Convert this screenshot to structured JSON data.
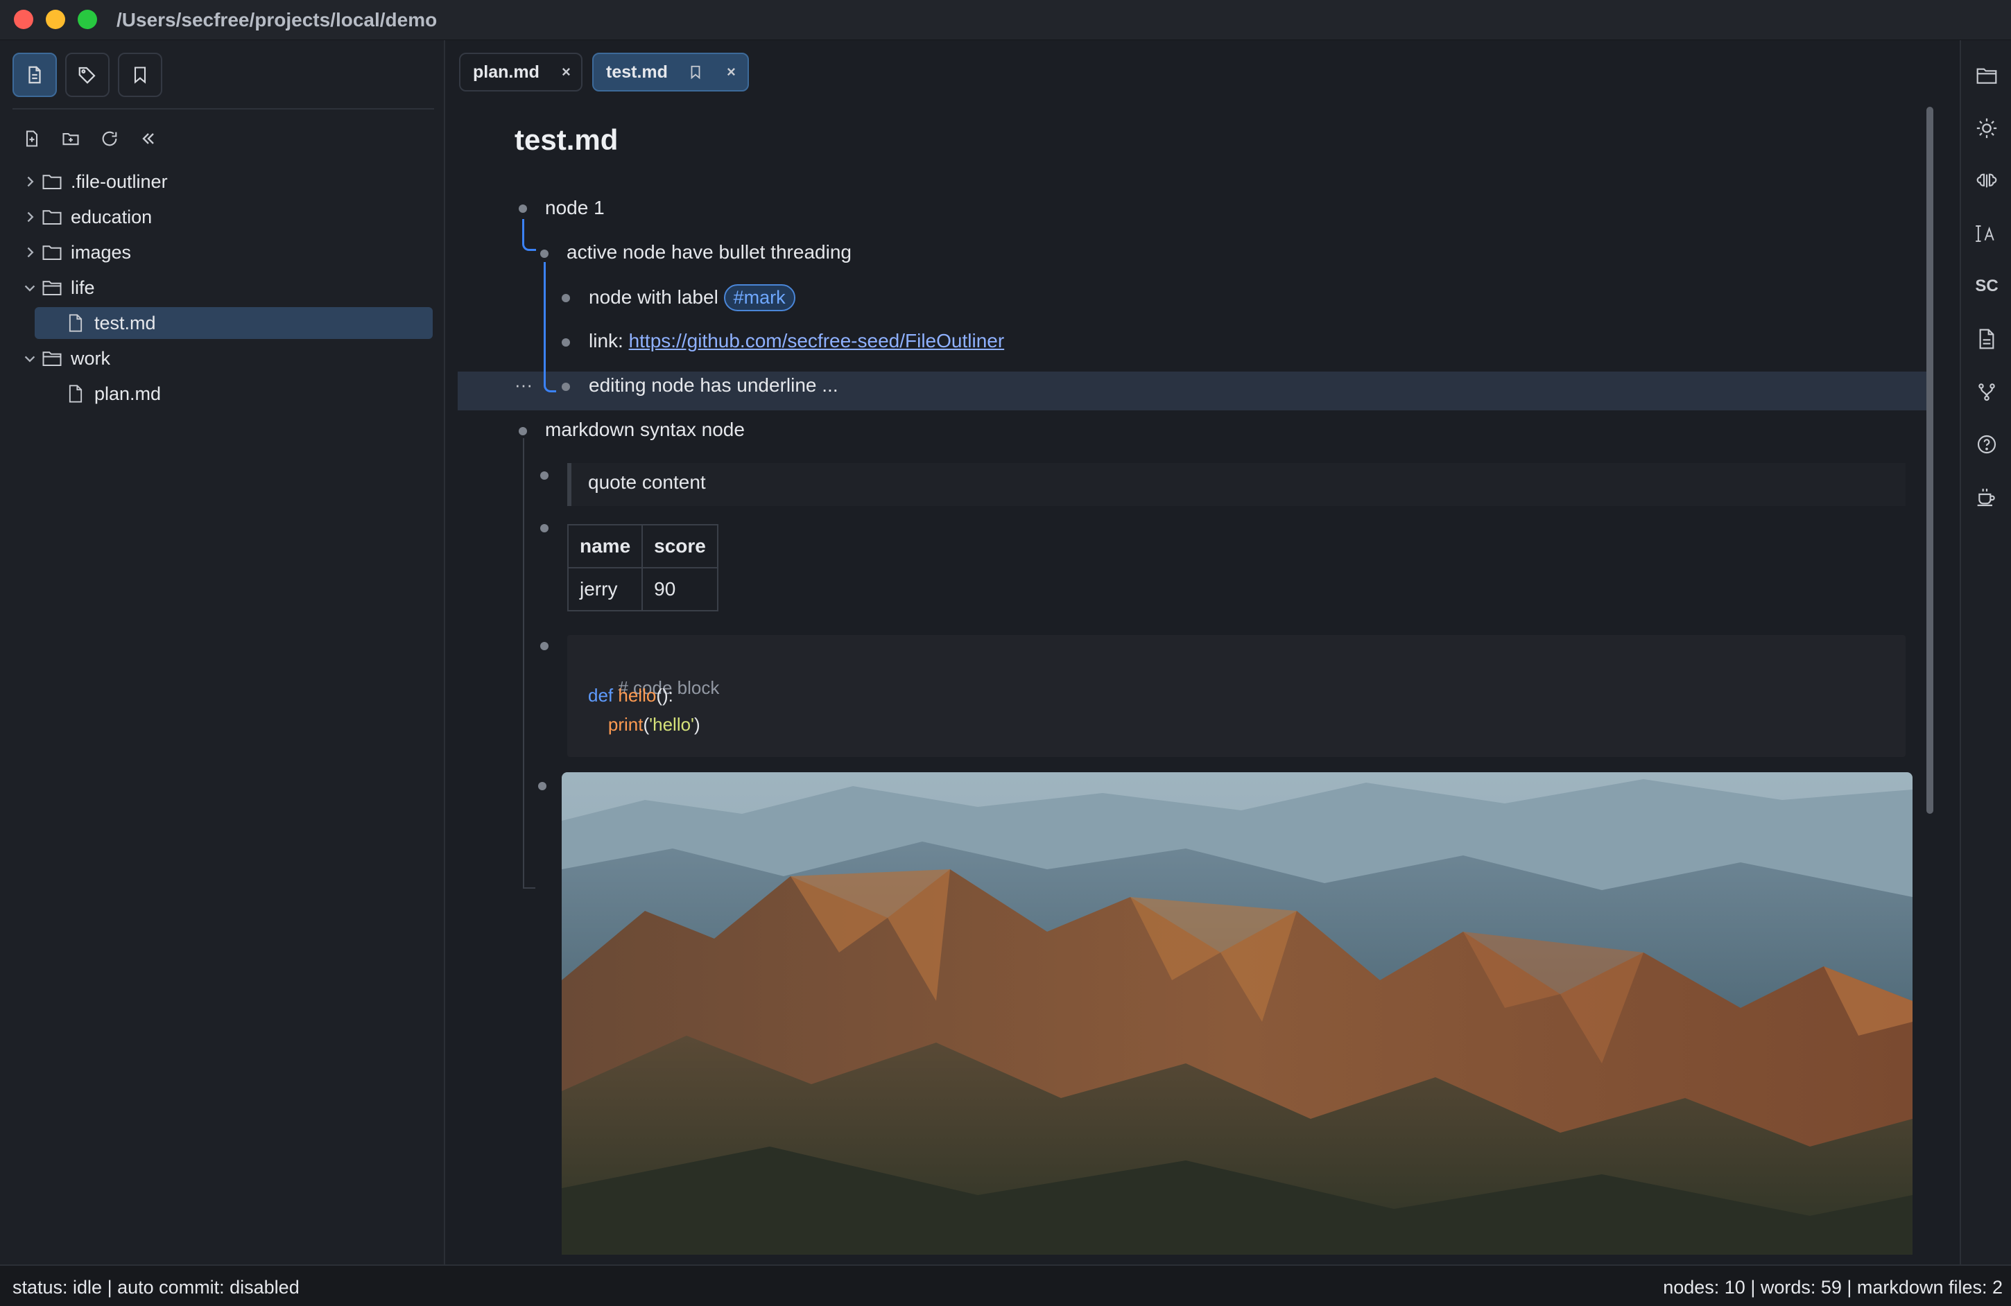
{
  "window": {
    "title": "/Users/secfree/projects/local/demo"
  },
  "sidebar": {
    "tabs": [
      {
        "name": "files-tab",
        "icon": "file-icon"
      },
      {
        "name": "tags-tab",
        "icon": "tag-icon"
      },
      {
        "name": "bookmarks-tab",
        "icon": "bookmark-icon"
      }
    ],
    "tools": [
      "new-file-icon",
      "new-folder-icon",
      "refresh-icon",
      "collapse-sidebar-icon"
    ],
    "tree": [
      {
        "label": ".file-outliner",
        "type": "folder",
        "expanded": false
      },
      {
        "label": "education",
        "type": "folder",
        "expanded": false
      },
      {
        "label": "images",
        "type": "folder",
        "expanded": false
      },
      {
        "label": "life",
        "type": "folder",
        "expanded": true
      },
      {
        "label": "test.md",
        "type": "file",
        "selected": true
      },
      {
        "label": "work",
        "type": "folder",
        "expanded": true
      },
      {
        "label": "plan.md",
        "type": "file",
        "selected": false
      }
    ]
  },
  "tabs": [
    {
      "label": "plan.md",
      "active": false,
      "close": "×"
    },
    {
      "label": "test.md",
      "active": true,
      "close": "×"
    }
  ],
  "editor": {
    "title": "test.md",
    "nodes": {
      "n1": "node 1",
      "n1a": "active node have bullet threading",
      "n1b_text": "node with label",
      "n1b_tag": "#mark",
      "n1c_prefix": "link:",
      "n1c_link": "https://github.com/secfree-seed/FileOutliner",
      "n1d": "editing node has underline ...",
      "n1d_menu": "···",
      "n2": "markdown syntax node",
      "quote": "quote content"
    },
    "table": {
      "headers": [
        "name",
        "score"
      ],
      "rows": [
        [
          "jerry",
          "90"
        ]
      ]
    },
    "code": {
      "line1": "# code block",
      "line2_kw": "def",
      "line2_fn": "hello",
      "line2_rest": "():",
      "line3_fn": "print",
      "line3_open": "(",
      "line3_str": "'hello'",
      "line3_close": ")"
    }
  },
  "rail": {
    "icons": [
      "folder-icon",
      "theme-icon",
      "brain-icon",
      "font-size-icon",
      "shortcuts-label",
      "document-icon",
      "branch-icon",
      "help-icon",
      "coffee-icon"
    ],
    "sc_label": "SC"
  },
  "status": {
    "left": "status: idle | auto commit: disabled",
    "right": "nodes: 10 | words: 59 | markdown files: 2"
  },
  "colors": {
    "accent": "#3b82f6",
    "selection": "#2e435d",
    "tab_active": "#2c4a6b",
    "tag": "#6fa8ff",
    "link": "#8fb1ff"
  }
}
